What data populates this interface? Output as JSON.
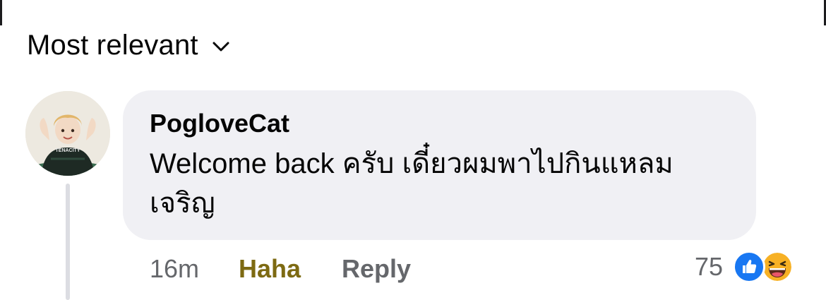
{
  "sort": {
    "label": "Most relevant",
    "icon": "chevron-down-icon"
  },
  "comment": {
    "author": "PogloveCat",
    "text": "Welcome back ครับ เดี๋ยวผมพาไปกินแหลม เจริญ",
    "avatar_jersey_text": "TENACITY",
    "time": "16m",
    "reaction_button": "Haha",
    "reply_button": "Reply",
    "reactions": {
      "count": "75",
      "icons": [
        "like-icon",
        "haha-icon"
      ]
    }
  },
  "colors": {
    "bubble": "#f0f0f4",
    "author_text": "#050505",
    "secondary_text": "#65676b",
    "haha_active": "#7d6a12",
    "like_blue": "#1877f2",
    "haha_yellow": "#f7b125"
  }
}
